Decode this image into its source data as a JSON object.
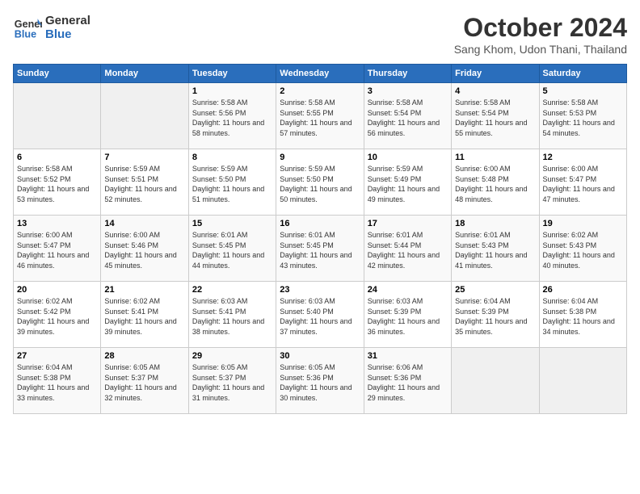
{
  "header": {
    "logo_line1": "General",
    "logo_line2": "Blue",
    "month_title": "October 2024",
    "location": "Sang Khom, Udon Thani, Thailand"
  },
  "weekdays": [
    "Sunday",
    "Monday",
    "Tuesday",
    "Wednesday",
    "Thursday",
    "Friday",
    "Saturday"
  ],
  "weeks": [
    [
      {
        "day": "",
        "info": ""
      },
      {
        "day": "",
        "info": ""
      },
      {
        "day": "1",
        "info": "Sunrise: 5:58 AM\nSunset: 5:56 PM\nDaylight: 11 hours and 58 minutes."
      },
      {
        "day": "2",
        "info": "Sunrise: 5:58 AM\nSunset: 5:55 PM\nDaylight: 11 hours and 57 minutes."
      },
      {
        "day": "3",
        "info": "Sunrise: 5:58 AM\nSunset: 5:54 PM\nDaylight: 11 hours and 56 minutes."
      },
      {
        "day": "4",
        "info": "Sunrise: 5:58 AM\nSunset: 5:54 PM\nDaylight: 11 hours and 55 minutes."
      },
      {
        "day": "5",
        "info": "Sunrise: 5:58 AM\nSunset: 5:53 PM\nDaylight: 11 hours and 54 minutes."
      }
    ],
    [
      {
        "day": "6",
        "info": "Sunrise: 5:58 AM\nSunset: 5:52 PM\nDaylight: 11 hours and 53 minutes."
      },
      {
        "day": "7",
        "info": "Sunrise: 5:59 AM\nSunset: 5:51 PM\nDaylight: 11 hours and 52 minutes."
      },
      {
        "day": "8",
        "info": "Sunrise: 5:59 AM\nSunset: 5:50 PM\nDaylight: 11 hours and 51 minutes."
      },
      {
        "day": "9",
        "info": "Sunrise: 5:59 AM\nSunset: 5:50 PM\nDaylight: 11 hours and 50 minutes."
      },
      {
        "day": "10",
        "info": "Sunrise: 5:59 AM\nSunset: 5:49 PM\nDaylight: 11 hours and 49 minutes."
      },
      {
        "day": "11",
        "info": "Sunrise: 6:00 AM\nSunset: 5:48 PM\nDaylight: 11 hours and 48 minutes."
      },
      {
        "day": "12",
        "info": "Sunrise: 6:00 AM\nSunset: 5:47 PM\nDaylight: 11 hours and 47 minutes."
      }
    ],
    [
      {
        "day": "13",
        "info": "Sunrise: 6:00 AM\nSunset: 5:47 PM\nDaylight: 11 hours and 46 minutes."
      },
      {
        "day": "14",
        "info": "Sunrise: 6:00 AM\nSunset: 5:46 PM\nDaylight: 11 hours and 45 minutes."
      },
      {
        "day": "15",
        "info": "Sunrise: 6:01 AM\nSunset: 5:45 PM\nDaylight: 11 hours and 44 minutes."
      },
      {
        "day": "16",
        "info": "Sunrise: 6:01 AM\nSunset: 5:45 PM\nDaylight: 11 hours and 43 minutes."
      },
      {
        "day": "17",
        "info": "Sunrise: 6:01 AM\nSunset: 5:44 PM\nDaylight: 11 hours and 42 minutes."
      },
      {
        "day": "18",
        "info": "Sunrise: 6:01 AM\nSunset: 5:43 PM\nDaylight: 11 hours and 41 minutes."
      },
      {
        "day": "19",
        "info": "Sunrise: 6:02 AM\nSunset: 5:43 PM\nDaylight: 11 hours and 40 minutes."
      }
    ],
    [
      {
        "day": "20",
        "info": "Sunrise: 6:02 AM\nSunset: 5:42 PM\nDaylight: 11 hours and 39 minutes."
      },
      {
        "day": "21",
        "info": "Sunrise: 6:02 AM\nSunset: 5:41 PM\nDaylight: 11 hours and 39 minutes."
      },
      {
        "day": "22",
        "info": "Sunrise: 6:03 AM\nSunset: 5:41 PM\nDaylight: 11 hours and 38 minutes."
      },
      {
        "day": "23",
        "info": "Sunrise: 6:03 AM\nSunset: 5:40 PM\nDaylight: 11 hours and 37 minutes."
      },
      {
        "day": "24",
        "info": "Sunrise: 6:03 AM\nSunset: 5:39 PM\nDaylight: 11 hours and 36 minutes."
      },
      {
        "day": "25",
        "info": "Sunrise: 6:04 AM\nSunset: 5:39 PM\nDaylight: 11 hours and 35 minutes."
      },
      {
        "day": "26",
        "info": "Sunrise: 6:04 AM\nSunset: 5:38 PM\nDaylight: 11 hours and 34 minutes."
      }
    ],
    [
      {
        "day": "27",
        "info": "Sunrise: 6:04 AM\nSunset: 5:38 PM\nDaylight: 11 hours and 33 minutes."
      },
      {
        "day": "28",
        "info": "Sunrise: 6:05 AM\nSunset: 5:37 PM\nDaylight: 11 hours and 32 minutes."
      },
      {
        "day": "29",
        "info": "Sunrise: 6:05 AM\nSunset: 5:37 PM\nDaylight: 11 hours and 31 minutes."
      },
      {
        "day": "30",
        "info": "Sunrise: 6:05 AM\nSunset: 5:36 PM\nDaylight: 11 hours and 30 minutes."
      },
      {
        "day": "31",
        "info": "Sunrise: 6:06 AM\nSunset: 5:36 PM\nDaylight: 11 hours and 29 minutes."
      },
      {
        "day": "",
        "info": ""
      },
      {
        "day": "",
        "info": ""
      }
    ]
  ]
}
